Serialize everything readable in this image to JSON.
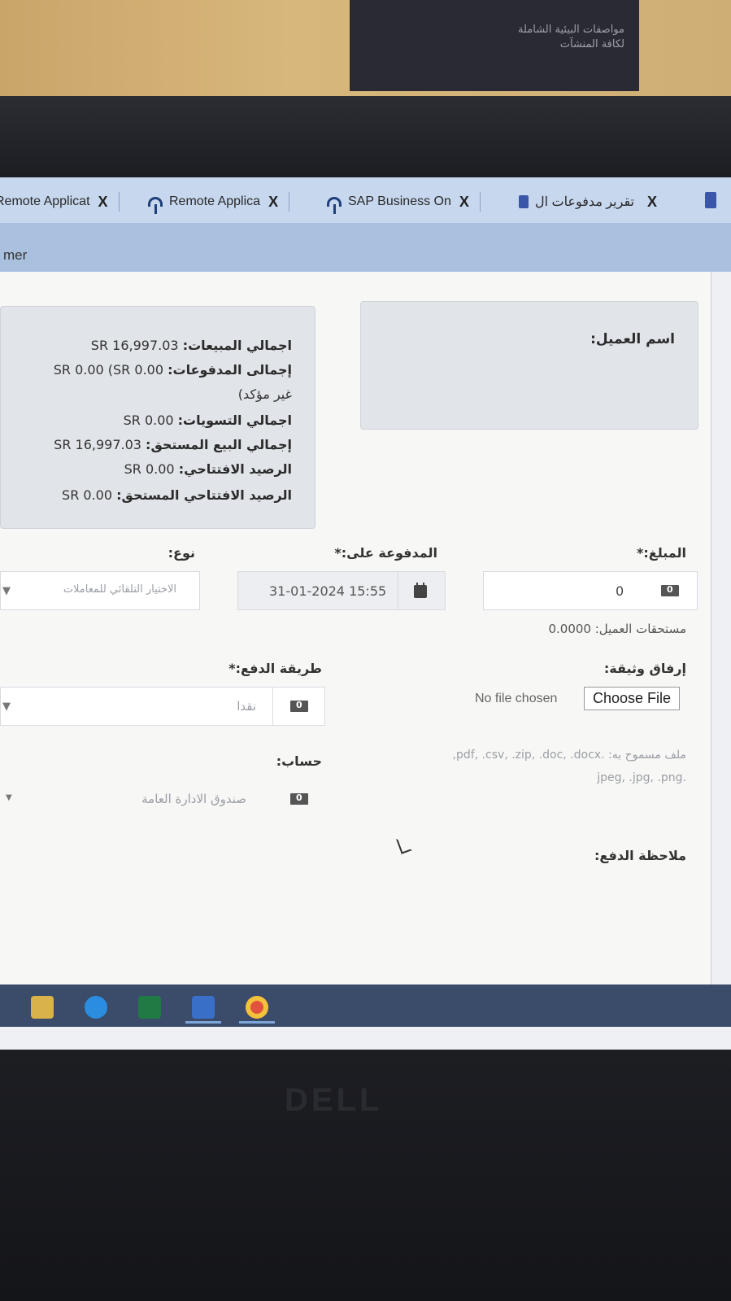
{
  "poster": {
    "line1": "مواصفات البيئية الشاملة",
    "line2": "لكافة المنشآت"
  },
  "tabs": [
    {
      "title": "Remote Applicat",
      "close": "X"
    },
    {
      "title": "Remote Applica",
      "close": "X"
    },
    {
      "title": "SAP Business On",
      "close": "X"
    },
    {
      "title": "تقرير مدفوعات ال",
      "close": "X"
    }
  ],
  "toolbar": {
    "crumb": "mer"
  },
  "summary": {
    "total_sales": {
      "label": "اجمالي المبيعات:",
      "value": "SR 16,997.03"
    },
    "total_payments": {
      "label": "إجمالى المدفوعات:",
      "value": "SR 0.00 (SR 0.00"
    },
    "unconfirmed": "غير مؤكد)",
    "total_settlements": {
      "label": "اجمالي التسويات:",
      "value": "SR 0.00"
    },
    "total_sale_due": {
      "label": "إجمالي البيع المستحق:",
      "value": "SR 16,997.03"
    },
    "opening_balance": {
      "label": "الرصيد الافتتاحي:",
      "value": "SR 0.00"
    },
    "opening_balance_due": {
      "label": "الرصيد الافتتاحي المستحق:",
      "value": "SR 0.00"
    }
  },
  "customer": {
    "label": "اسم العميل:"
  },
  "form": {
    "amount_label": "المبلغ:*",
    "amount_value": "0",
    "paid_on_label": "المدفوعة على:*",
    "paid_on_value": "31-01-2024 15:55",
    "type_label": "نوع:",
    "type_placeholder": "الاختيار التلقائي للمعاملات",
    "customer_dues": "مستحقات العميل: 0.0000",
    "attach_label": "إرفاق وثيقة:",
    "choose_file": "Choose File",
    "no_file": "No file chosen",
    "allowed_files_1": "ملف مسموح به: .pdf, .csv, .zip, .doc, .docx,",
    "allowed_files_2": ".jpeg, .jpg, .png",
    "payment_method_label": "طريقة الدفع:*",
    "payment_method_value": "نقدا",
    "account_label": "حساب:",
    "account_value": "صندوق الادارة العامة",
    "payment_note_label": "ملاحظة الدفع:"
  },
  "brand": "DELL"
}
